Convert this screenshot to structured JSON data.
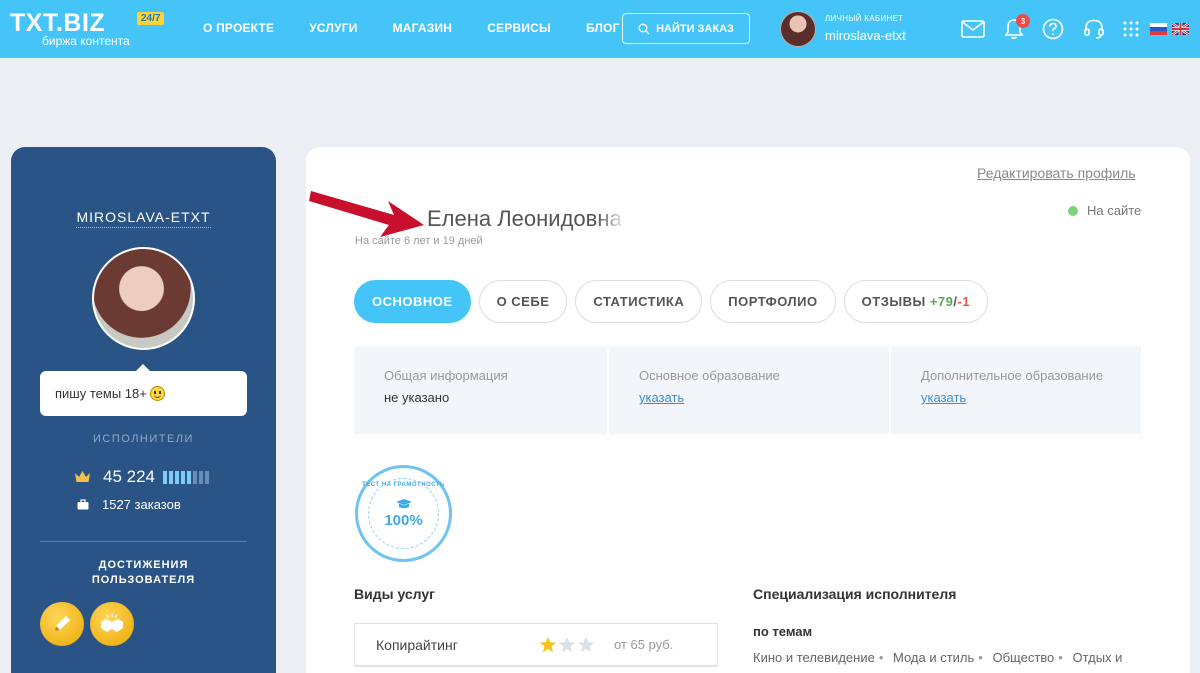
{
  "header": {
    "logo": "TXT.BIZ",
    "logo_badge": "24/7",
    "logo_sub": "биржа контента",
    "nav": [
      "О ПРОЕКТЕ",
      "УСЛУГИ",
      "МАГАЗИН",
      "СЕРВИСЫ",
      "БЛОГ"
    ],
    "find_order": "НАЙТИ ЗАКАЗ",
    "account_caption": "ЛИЧНЫЙ КАБИНЕТ",
    "account_login": "miroslava-etxt",
    "notifications_count": "3",
    "accent_color": "#45c5f7"
  },
  "sidebar": {
    "login": "MIROSLAVA-ETXT",
    "status": "пишу темы 18+",
    "role": "ИСПОЛНИТЕЛИ",
    "rating": "45 224",
    "rating_level": {
      "filled": 5,
      "total": 8
    },
    "orders": "1527 заказов",
    "achievements_title_1": "ДОСТИЖЕНИЯ",
    "achievements_title_2": "ПОЛЬЗОВАТЕЛЯ",
    "achievement_icons": [
      "pencil-icon",
      "handshake-icon"
    ]
  },
  "profile": {
    "edit_link": "Редактировать профиль",
    "online_status": "На сайте",
    "name": "Елена Леонидовна",
    "since": "На сайте 6 лет и 19 дней",
    "tabs": {
      "main": "ОСНОВНОЕ",
      "about": "О СЕБЕ",
      "stats": "СТАТИСТИКА",
      "portfolio": "ПОРТФОЛИО",
      "reviews": "ОТЗЫВЫ",
      "reviews_pos": "+79",
      "reviews_slash": "/",
      "reviews_neg": "-1"
    },
    "info": {
      "general_label": "Общая информация",
      "general_value": "не указано",
      "edu_label": "Основное образование",
      "edu_value": "указать",
      "extra_edu_label": "Дополнительное образование",
      "extra_edu_value": "указать"
    },
    "test_badge": {
      "text": "ТЕСТ НА ГРАМОТНОСТЬ",
      "percent": "100%"
    },
    "services_title": "Виды услуг",
    "services": [
      {
        "name": "Копирайтинг",
        "stars": 1,
        "stars_total": 3,
        "price": "от 65 руб."
      }
    ],
    "specialization_title": "Специализация исполнителя",
    "topics_label": "по темам",
    "topics": [
      "Кино и телевидение",
      "Мода и стиль",
      "Общество",
      "Отдых и"
    ]
  }
}
